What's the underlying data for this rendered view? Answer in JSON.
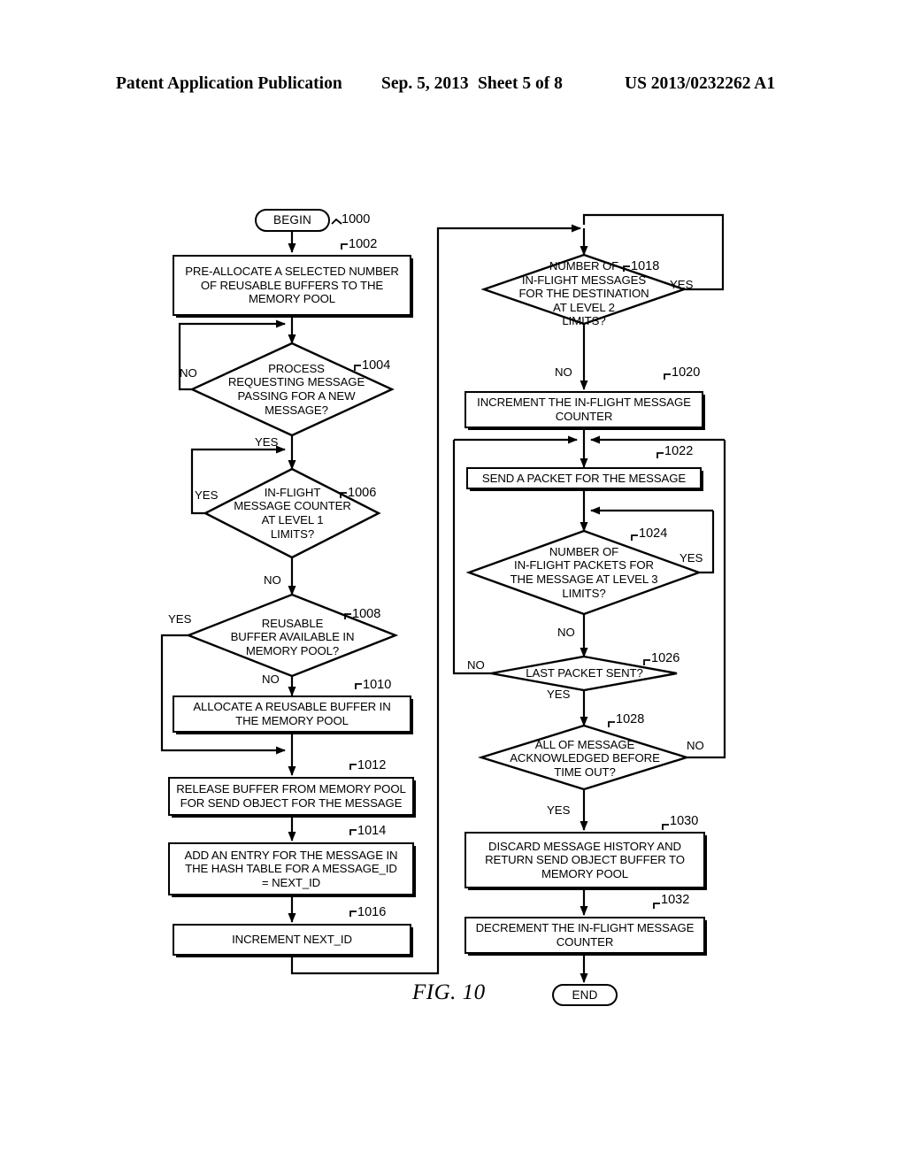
{
  "header": {
    "publication": "Patent Application Publication",
    "date": "Sep. 5, 2013",
    "sheet": "Sheet 5 of 8",
    "patent_number": "US 2013/0232262 A1"
  },
  "figure": {
    "label": "FIG. 10"
  },
  "flowchart": {
    "nodes": [
      {
        "id": "1000",
        "type": "terminator",
        "text": "BEGIN",
        "ref": "1000"
      },
      {
        "id": "1002",
        "type": "process",
        "text": "PRE-ALLOCATE A SELECTED NUMBER OF REUSABLE BUFFERS TO THE MEMORY POOL",
        "ref": "1002"
      },
      {
        "id": "1004",
        "type": "decision",
        "text": "PROCESS REQUESTING MESSAGE PASSING FOR A NEW MESSAGE?",
        "ref": "1004"
      },
      {
        "id": "1006",
        "type": "decision",
        "text": "IN-FLIGHT MESSAGE COUNTER AT LEVEL 1 LIMITS?",
        "ref": "1006"
      },
      {
        "id": "1008",
        "type": "decision",
        "text": "REUSABLE BUFFER AVAILABLE IN MEMORY POOL?",
        "ref": "1008"
      },
      {
        "id": "1010",
        "type": "process",
        "text": "ALLOCATE A REUSABLE BUFFER IN THE MEMORY POOL",
        "ref": "1010"
      },
      {
        "id": "1012",
        "type": "process",
        "text": "RELEASE BUFFER FROM MEMORY POOL FOR SEND OBJECT FOR THE MESSAGE",
        "ref": "1012"
      },
      {
        "id": "1014",
        "type": "process",
        "text": "ADD AN ENTRY FOR THE MESSAGE IN THE HASH TABLE FOR A MESSAGE_ID = NEXT_ID",
        "ref": "1014"
      },
      {
        "id": "1016",
        "type": "process",
        "text": "INCREMENT NEXT_ID",
        "ref": "1016"
      },
      {
        "id": "1018",
        "type": "decision",
        "text": "NUMBER OF IN-FLIGHT MESSAGES FOR THE DESTINATION AT LEVEL 2 LIMITS?",
        "ref": "1018"
      },
      {
        "id": "1020",
        "type": "process",
        "text": "INCREMENT THE IN-FLIGHT MESSAGE COUNTER",
        "ref": "1020"
      },
      {
        "id": "1022",
        "type": "process",
        "text": "SEND A PACKET FOR THE MESSAGE",
        "ref": "1022"
      },
      {
        "id": "1024",
        "type": "decision",
        "text": "NUMBER OF IN-FLIGHT PACKETS FOR THE MESSAGE AT LEVEL 3 LIMITS?",
        "ref": "1024"
      },
      {
        "id": "1026",
        "type": "decision",
        "text": "LAST PACKET SENT?",
        "ref": "1026"
      },
      {
        "id": "1028",
        "type": "decision",
        "text": "ALL OF MESSAGE ACKNOWLEDGED BEFORE TIME OUT?",
        "ref": "1028"
      },
      {
        "id": "1030",
        "type": "process",
        "text": "DISCARD MESSAGE HISTORY AND RETURN SEND OBJECT BUFFER TO MEMORY POOL",
        "ref": "1030"
      },
      {
        "id": "1032",
        "type": "process",
        "text": "DECREMENT THE IN-FLIGHT MESSAGE COUNTER",
        "ref": "1032"
      },
      {
        "id": "end",
        "type": "terminator",
        "text": "END",
        "ref": ""
      }
    ],
    "edge_labels": {
      "e1004_no": "NO",
      "e1004_yes": "YES",
      "e1006_yes": "YES",
      "e1006_no": "NO",
      "e1008_yes": "YES",
      "e1008_no": "NO",
      "e1018_yes": "YES",
      "e1018_no": "NO",
      "e1024_yes": "YES",
      "e1024_no": "NO",
      "e1026_no": "NO",
      "e1026_yes": "YES",
      "e1028_no": "NO",
      "e1028_yes": "YES"
    },
    "text_lines": {
      "n1002": [
        "PRE-ALLOCATE A SELECTED NUMBER",
        "OF REUSABLE BUFFERS TO THE",
        "MEMORY POOL"
      ],
      "n1004": [
        "PROCESS",
        "REQUESTING MESSAGE",
        "PASSING FOR A NEW",
        "MESSAGE?"
      ],
      "n1006": [
        "IN-FLIGHT",
        "MESSAGE COUNTER",
        "AT LEVEL 1",
        "LIMITS?"
      ],
      "n1008": [
        "REUSABLE",
        "BUFFER AVAILABLE IN",
        "MEMORY POOL?"
      ],
      "n1010": [
        "ALLOCATE A REUSABLE BUFFER IN",
        "THE MEMORY POOL"
      ],
      "n1012": [
        "RELEASE BUFFER FROM MEMORY POOL",
        "FOR SEND OBJECT FOR THE MESSAGE"
      ],
      "n1014": [
        "ADD AN ENTRY FOR THE MESSAGE IN",
        "THE HASH TABLE FOR A MESSAGE_ID",
        "= NEXT_ID"
      ],
      "n1016": [
        "INCREMENT NEXT_ID"
      ],
      "n1018": [
        "NUMBER OF",
        "IN-FLIGHT MESSAGES",
        "FOR THE DESTINATION",
        "AT LEVEL 2",
        "LIMITS?"
      ],
      "n1020": [
        "INCREMENT THE IN-FLIGHT MESSAGE",
        "COUNTER"
      ],
      "n1022": [
        "SEND A PACKET FOR THE MESSAGE"
      ],
      "n1024": [
        "NUMBER OF",
        "IN-FLIGHT PACKETS FOR",
        "THE MESSAGE AT LEVEL 3",
        "LIMITS?"
      ],
      "n1026": [
        "LAST PACKET SENT?"
      ],
      "n1028": [
        "ALL OF MESSAGE",
        "ACKNOWLEDGED BEFORE",
        "TIME OUT?"
      ],
      "n1030": [
        "DISCARD MESSAGE HISTORY AND",
        "RETURN SEND OBJECT BUFFER TO",
        "MEMORY POOL"
      ],
      "n1032": [
        "DECREMENT THE IN-FLIGHT MESSAGE",
        "COUNTER"
      ]
    },
    "refs": {
      "r1000": "1000",
      "r1002": "1002",
      "r1004": "1004",
      "r1006": "1006",
      "r1008": "1008",
      "r1010": "1010",
      "r1012": "1012",
      "r1014": "1014",
      "r1016": "1016",
      "r1018": "1018",
      "r1020": "1020",
      "r1022": "1022",
      "r1024": "1024",
      "r1026": "1026",
      "r1028": "1028",
      "r1030": "1030",
      "r1032": "1032"
    },
    "terminators": {
      "begin": "BEGIN",
      "end": "END"
    }
  }
}
